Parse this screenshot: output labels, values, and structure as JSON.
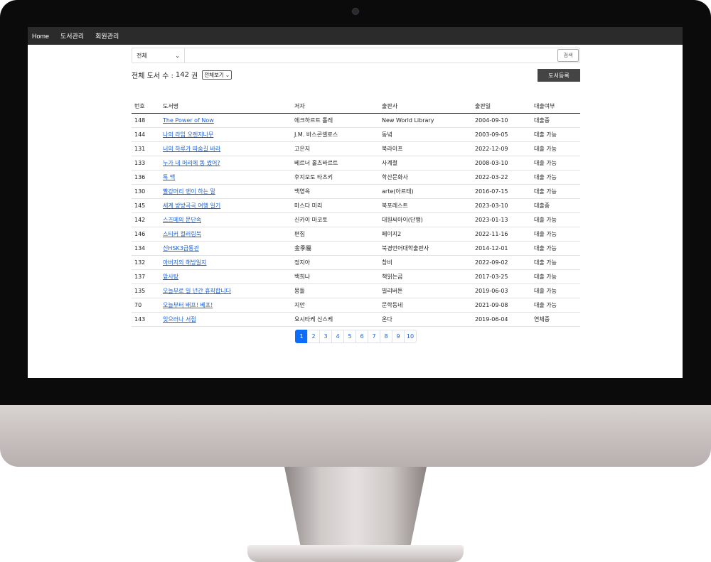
{
  "nav": {
    "items": [
      "Home",
      "도서관리",
      "회원관리"
    ]
  },
  "search": {
    "category": "전체",
    "button": "검색"
  },
  "summary": {
    "label": "전체 도서 수 :",
    "count": "142",
    "unit": "권",
    "view_option": "전체보기",
    "register_button": "도서등록"
  },
  "table": {
    "headers": [
      "번호",
      "도서명",
      "저자",
      "출판사",
      "출판일",
      "대출여부"
    ],
    "rows": [
      [
        "148",
        "The Power of Now",
        "에크하르트 톨레",
        "New World Library",
        "2004-09-10",
        "대출중"
      ],
      [
        "144",
        "나의 라임 오렌지나무",
        "J.M. 바스콘셀로스",
        "동녘",
        "2003-09-05",
        "대출 가능"
      ],
      [
        "131",
        "너의 하루가 따숨길 바라",
        "고은지",
        "북라이프",
        "2022-12-09",
        "대출 가능"
      ],
      [
        "133",
        "누가 내 머리에 똥 쌌어?",
        "베르너 홀츠바르트",
        "사계절",
        "2008-03-10",
        "대출 가능"
      ],
      [
        "136",
        "툭 백",
        "후지모토 타츠키",
        "학산문화사",
        "2022-03-22",
        "대출 가능"
      ],
      [
        "130",
        "빨강머리 앤이 하는 말",
        "백영옥",
        "arte(아르테)",
        "2016-07-15",
        "대출 가능"
      ],
      [
        "145",
        "세계 방방곡곡 여행 일기",
        "마스다 미리",
        "북포레스트",
        "2023-03-10",
        "대출중"
      ],
      [
        "142",
        "스즈메의 문단속",
        "신카이 마코토",
        "대원씨아이(단행)",
        "2023-01-13",
        "대출 가능"
      ],
      [
        "146",
        "스티커 컬러링북",
        "편집",
        "페이지2",
        "2022-11-16",
        "대출 가능"
      ],
      [
        "134",
        "신HSK3급통관",
        "金季屬",
        "북경언어대학출판사",
        "2014-12-01",
        "대출 가능"
      ],
      [
        "132",
        "아버지의 해방일지",
        "정지아",
        "창비",
        "2022-09-02",
        "대출 가능"
      ],
      [
        "137",
        "앞사탕",
        "백희나",
        "책읽는곰",
        "2017-03-25",
        "대출 가능"
      ],
      [
        "135",
        "오늘부로 일 년간 휴직합니다",
        "몽돌",
        "빌리버튼",
        "2019-06-03",
        "대출 가능"
      ],
      [
        "70",
        "오늘부터 배프! 베프!",
        "지안",
        "문학동네",
        "2021-09-08",
        "대출 가능"
      ],
      [
        "143",
        "잊으러나 서점",
        "요시타케 신스케",
        "온다",
        "2019-06-04",
        "연체중"
      ]
    ]
  },
  "pagination": {
    "pages": [
      "1",
      "2",
      "3",
      "4",
      "5",
      "6",
      "7",
      "8",
      "9",
      "10"
    ],
    "current": "1"
  }
}
